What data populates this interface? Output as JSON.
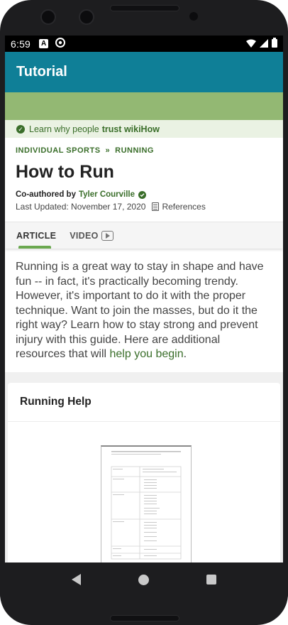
{
  "status_bar": {
    "time": "6:59",
    "icons": [
      "a-notification-icon",
      "at-sign-icon",
      "wifi-icon",
      "signal-icon",
      "battery-icon"
    ]
  },
  "app_bar": {
    "title": "Tutorial"
  },
  "trust_bar": {
    "text": "Learn why people",
    "bold": "trust wikiHow"
  },
  "breadcrumb": {
    "items": [
      "INDIVIDUAL SPORTS",
      "RUNNING"
    ],
    "separator": "»"
  },
  "article": {
    "title": "How to Run",
    "coauthored_label": "Co-authored by",
    "author": "Tyler Courville",
    "last_updated": "Last Updated: November 17, 2020",
    "references_label": "References"
  },
  "tabs": {
    "article": "ARTICLE",
    "video": "VIDEO"
  },
  "intro": {
    "text": "Running is a great way to stay in shape and have fun -- in fact, it's practically becoming trendy. However, it's important to do it with the proper technique. Want to join the masses, but do it the right way? Learn how to stay strong and prevent injury with this guide. Here are additional resources that will",
    "link": "help you begin",
    "end": "."
  },
  "section": {
    "title": "Running Help"
  },
  "colors": {
    "app_bar": "#0f7f97",
    "banner": "#93b873",
    "accent_green": "#3a6e2a",
    "trust_bg": "#eaf2e3"
  },
  "navigation": {
    "icons": [
      "back-icon",
      "home-icon",
      "recents-icon"
    ]
  }
}
